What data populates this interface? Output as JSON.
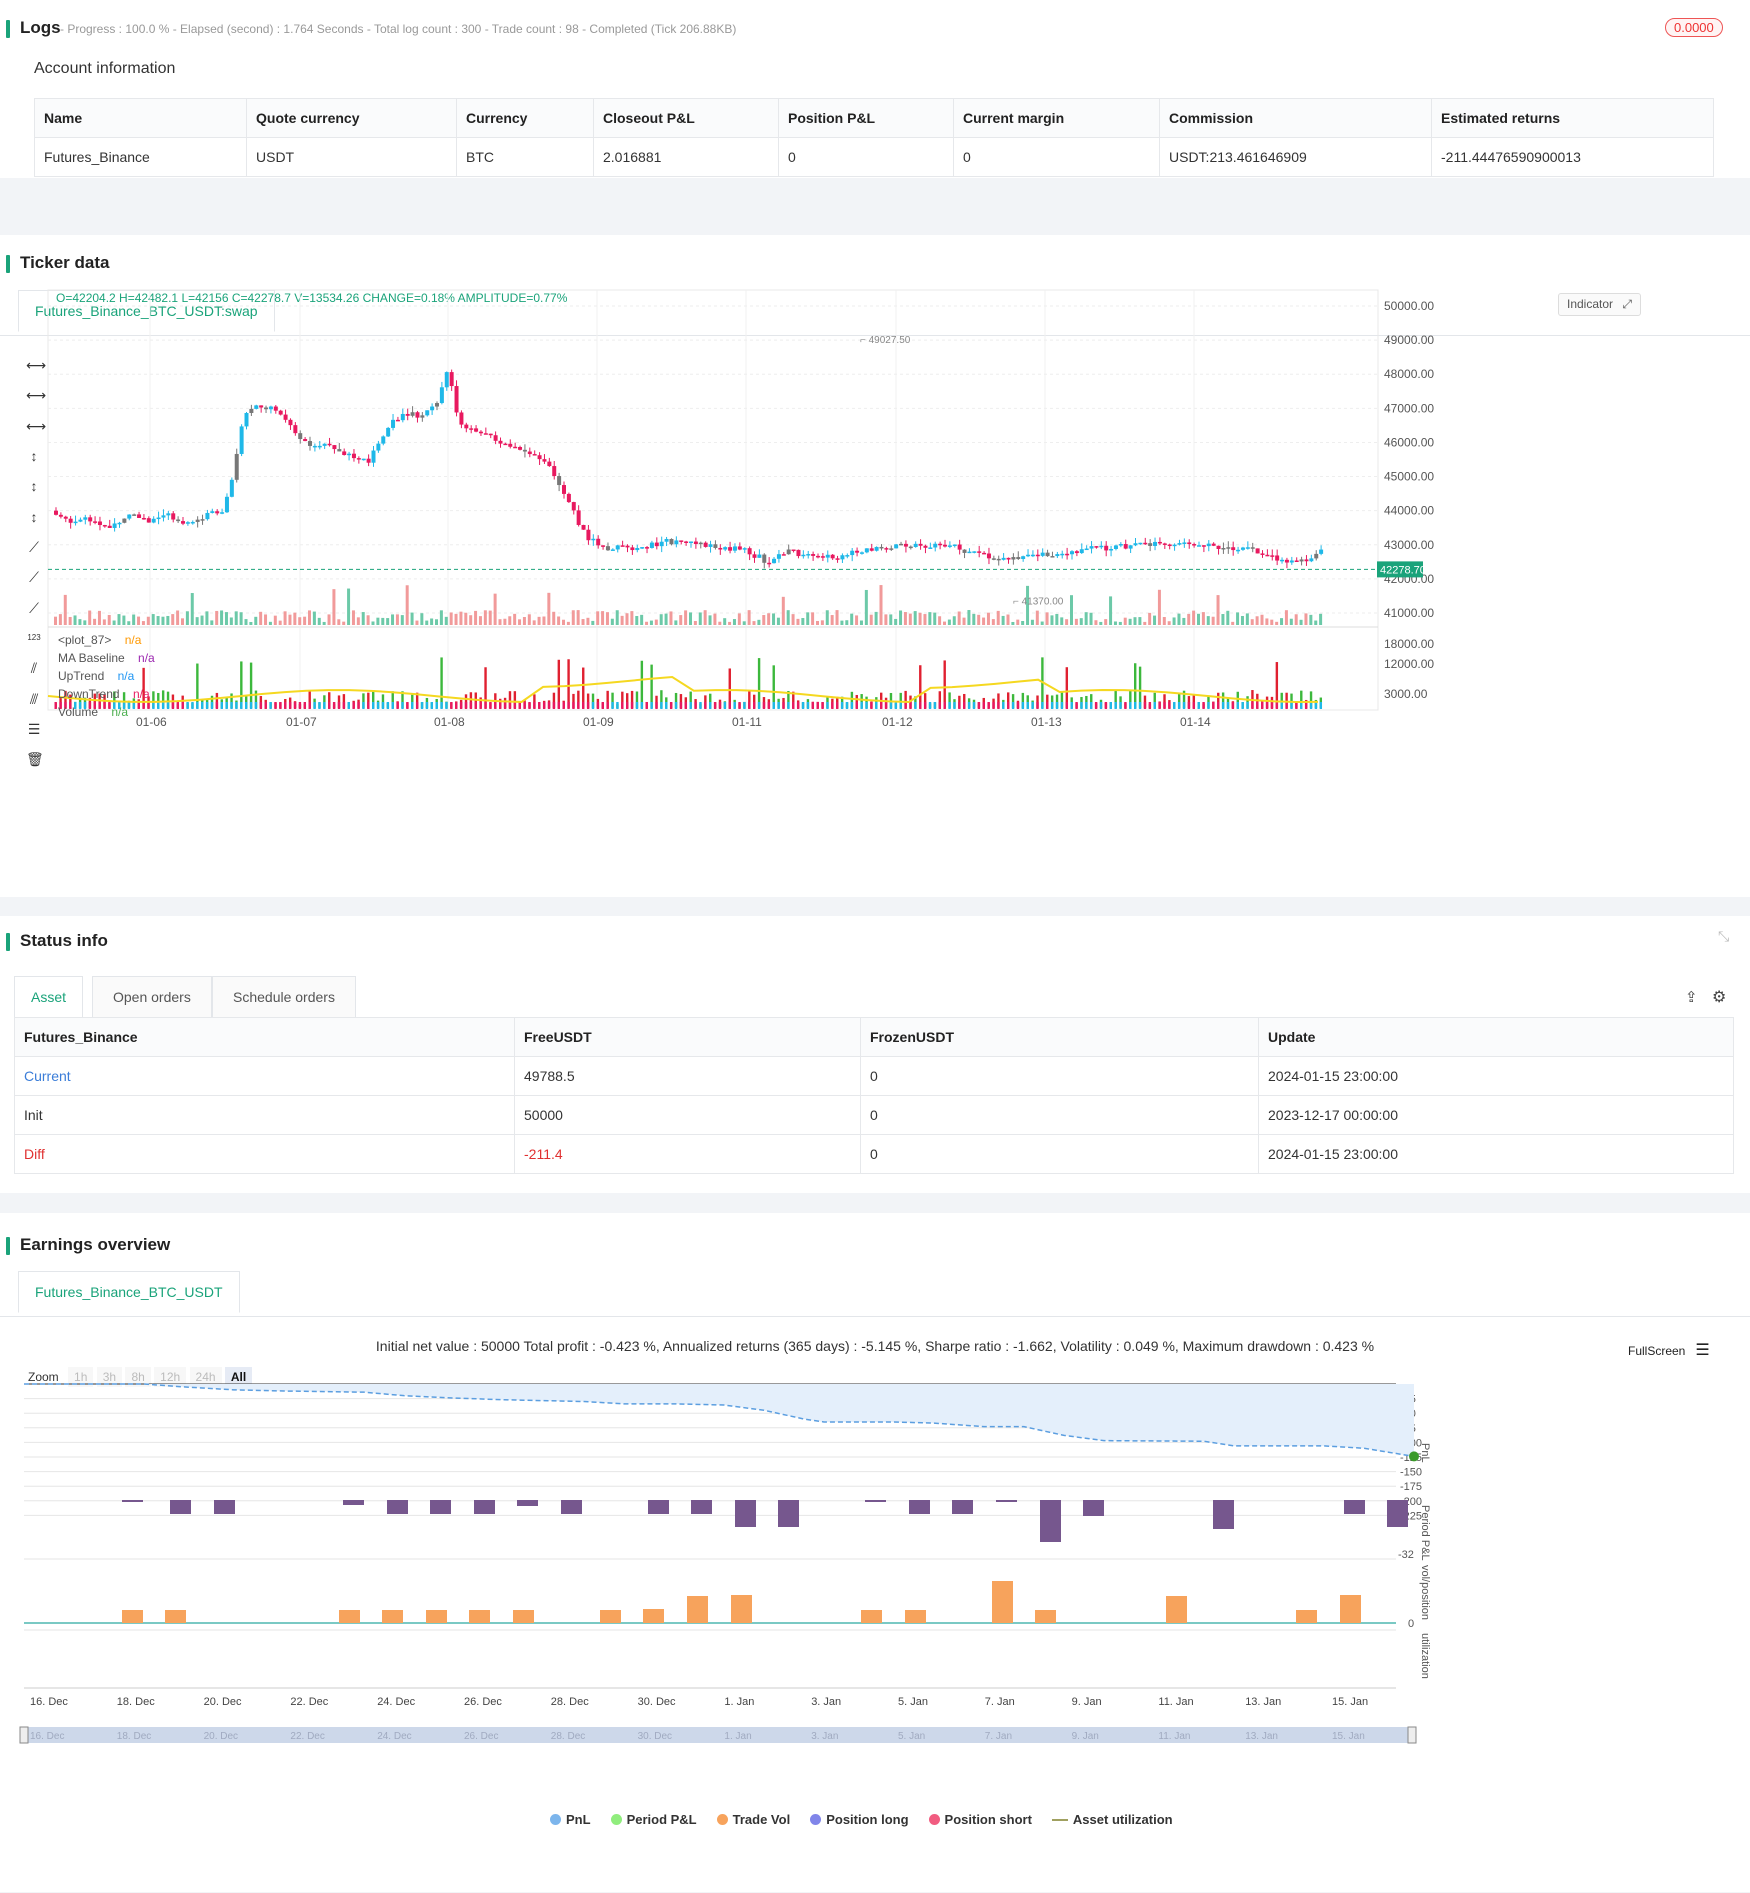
{
  "logs": {
    "title": "Logs",
    "progress": "- Progress : 100.0 % - Elapsed (second) : 1.764  Seconds - Total log count : 300 - Trade count : 98 - Completed (Tick 206.88KB)",
    "badge": "0.0000",
    "account_title": "Account information",
    "columns": [
      "Name",
      "Quote currency",
      "Currency",
      "Closeout P&L",
      "Position P&L",
      "Current margin",
      "Commission",
      "Estimated returns"
    ],
    "row": [
      "Futures_Binance",
      "USDT",
      "BTC",
      "2.016881",
      "0",
      "0",
      "USDT:213.461646909",
      "-211.44476590900013"
    ]
  },
  "ticker": {
    "title": "Ticker data",
    "tab": "Futures_Binance_BTC_USDT:swap",
    "ohlc": "O=42204.2 H=42482.1 L=42156 C=42278.7 V=13534.26 CHANGE=0.18% AMPLITUDE=0.77%",
    "indicator_btn": "Indicator",
    "price_label": "42278.70",
    "high_label": "49027.50",
    "low_label": "41370.00",
    "price_ticks": [
      "50000.00",
      "49000.00",
      "48000.00",
      "47000.00",
      "46000.00",
      "45000.00",
      "44000.00",
      "43000.00",
      "42000.00",
      "41000.00"
    ],
    "vol_ticks": [
      "18000.00",
      "12000.00",
      "3000.00"
    ],
    "date_ticks": [
      "01-06",
      "01-07",
      "01-08",
      "01-09",
      "01-11",
      "01-12",
      "01-13",
      "01-14"
    ],
    "legend": [
      {
        "name": "<plot_87>",
        "val": "n/a",
        "color": "#ff9800"
      },
      {
        "name": "MA Baseline",
        "val": "n/a",
        "color": "#9c27b0"
      },
      {
        "name": "UpTrend",
        "val": "n/a",
        "color": "#2196f3"
      },
      {
        "name": "DownTrend",
        "val": "n/a",
        "color": "#e91e63"
      },
      {
        "name": "Volume",
        "val": "n/a",
        "color": "#4caf50"
      }
    ],
    "colors": {
      "up": "#1fb8e8",
      "down": "#e8195f",
      "neutral": "#777777",
      "green": "#26a69a",
      "red": "#f08080"
    }
  },
  "status": {
    "title": "Status info",
    "tabs": [
      "Asset",
      "Open orders",
      "Schedule orders"
    ],
    "columns": [
      "Futures_Binance",
      "FreeUSDT",
      "FrozenUSDT",
      "Update"
    ],
    "rows": [
      [
        "Current",
        "49788.5",
        "0",
        "2024-01-15 23:00:00"
      ],
      [
        "Init",
        "50000",
        "0",
        "2023-12-17 00:00:00"
      ],
      [
        "Diff",
        "-211.4",
        "0",
        "2024-01-15 23:00:00"
      ]
    ]
  },
  "earnings": {
    "title": "Earnings overview",
    "tab": "Futures_Binance_BTC_USDT",
    "summary": "Initial net value : 50000 Total profit : -0.423 %, Annualized returns (365 days) : -5.145 %, Sharpe ratio : -1.662, Volatility : 0.049 %, Maximum drawdown : 0.423 %",
    "fullscreen": "FullScreen",
    "zoom_label": "Zoom",
    "zoom_options": [
      "1h",
      "3h",
      "8h",
      "12h",
      "24h",
      "All"
    ],
    "pnl_ticks": [
      "-25",
      "-50",
      "-75",
      "-100",
      "-125",
      "-150",
      "-175",
      "-200",
      "-225"
    ],
    "axis_labels": [
      "PnL",
      "Period P&L",
      "vol/position",
      "utilization"
    ],
    "period_min": "-32",
    "vol_zero": "0",
    "util_zero": "0",
    "date_ticks": [
      "16. Dec",
      "18. Dec",
      "20. Dec",
      "22. Dec",
      "24. Dec",
      "26. Dec",
      "28. Dec",
      "30. Dec",
      "1. Jan",
      "3. Jan",
      "5. Jan",
      "7. Jan",
      "9. Jan",
      "11. Jan",
      "13. Jan",
      "15. Jan"
    ],
    "legend": [
      {
        "name": "PnL",
        "color": "#7cb5ec"
      },
      {
        "name": "Period P&L",
        "color": "#90ed7d"
      },
      {
        "name": "Trade Vol",
        "color": "#f7a35c"
      },
      {
        "name": "Position long",
        "color": "#8085e9"
      },
      {
        "name": "Position short",
        "color": "#f15c80"
      },
      {
        "name": "Asset utilization",
        "color": "#a0a060"
      }
    ]
  }
}
